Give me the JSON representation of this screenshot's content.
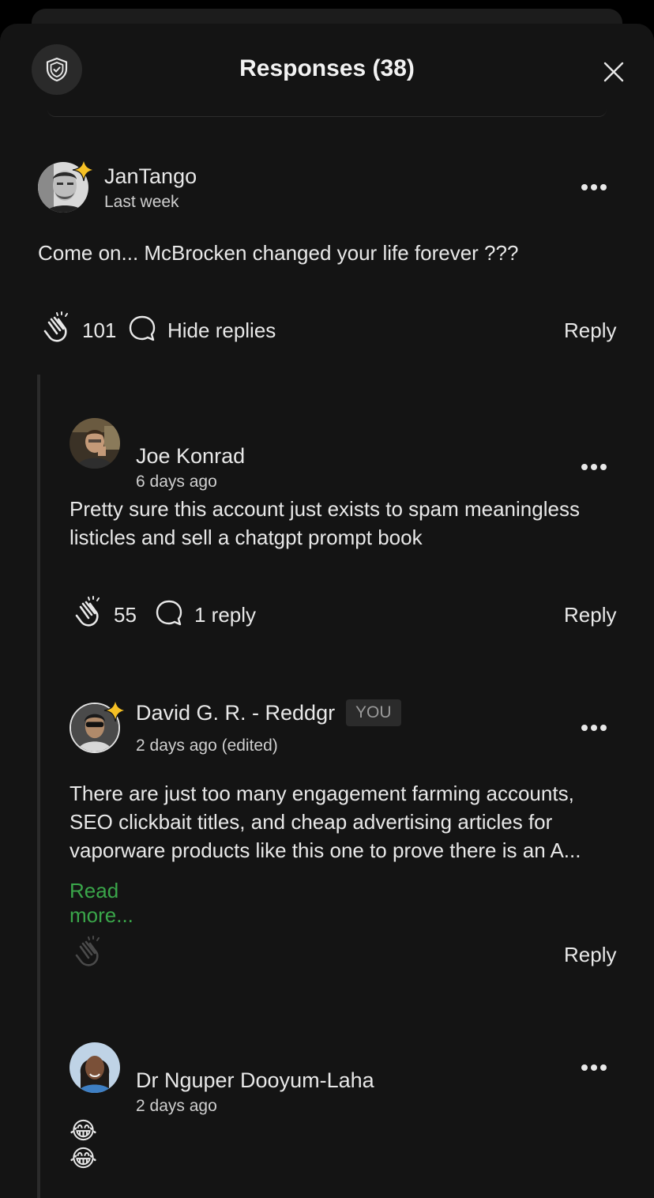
{
  "header": {
    "title": "Responses (38)",
    "shield_icon": "shield-check-icon",
    "close_icon": "close-icon"
  },
  "comments": [
    {
      "author": "JanTango",
      "time": "Last week",
      "text": "Come on... McBrocken changed your life forever ???",
      "claps": "101",
      "replies_label": "Hide replies",
      "reply_label": "Reply",
      "member_star": true
    },
    {
      "author": "Joe Konrad",
      "time": "6 days ago",
      "text": "Pretty sure this account just exists to spam meaningless listicles and sell a chatgpt prompt book",
      "claps": "55",
      "replies_label": "1 reply",
      "reply_label": "Reply",
      "member_star": false
    },
    {
      "author": "David G. R. - Reddgr",
      "badge": "YOU",
      "time": "2 days ago (edited)",
      "text": "There are just too many engagement farming accounts, SEO clickbait titles, and cheap advertising articles for vaporware products like this one to prove there is an A...",
      "read_more": "Read more...",
      "reply_label": "Reply",
      "member_star": true
    },
    {
      "author": "Dr Nguper Dooyum-Laha",
      "time": "2 days ago",
      "text": "😂😂",
      "member_star": false
    }
  ],
  "colors": {
    "accent_green": "#3aa64a",
    "star_gold": "#f5c025",
    "background": "#141414"
  }
}
